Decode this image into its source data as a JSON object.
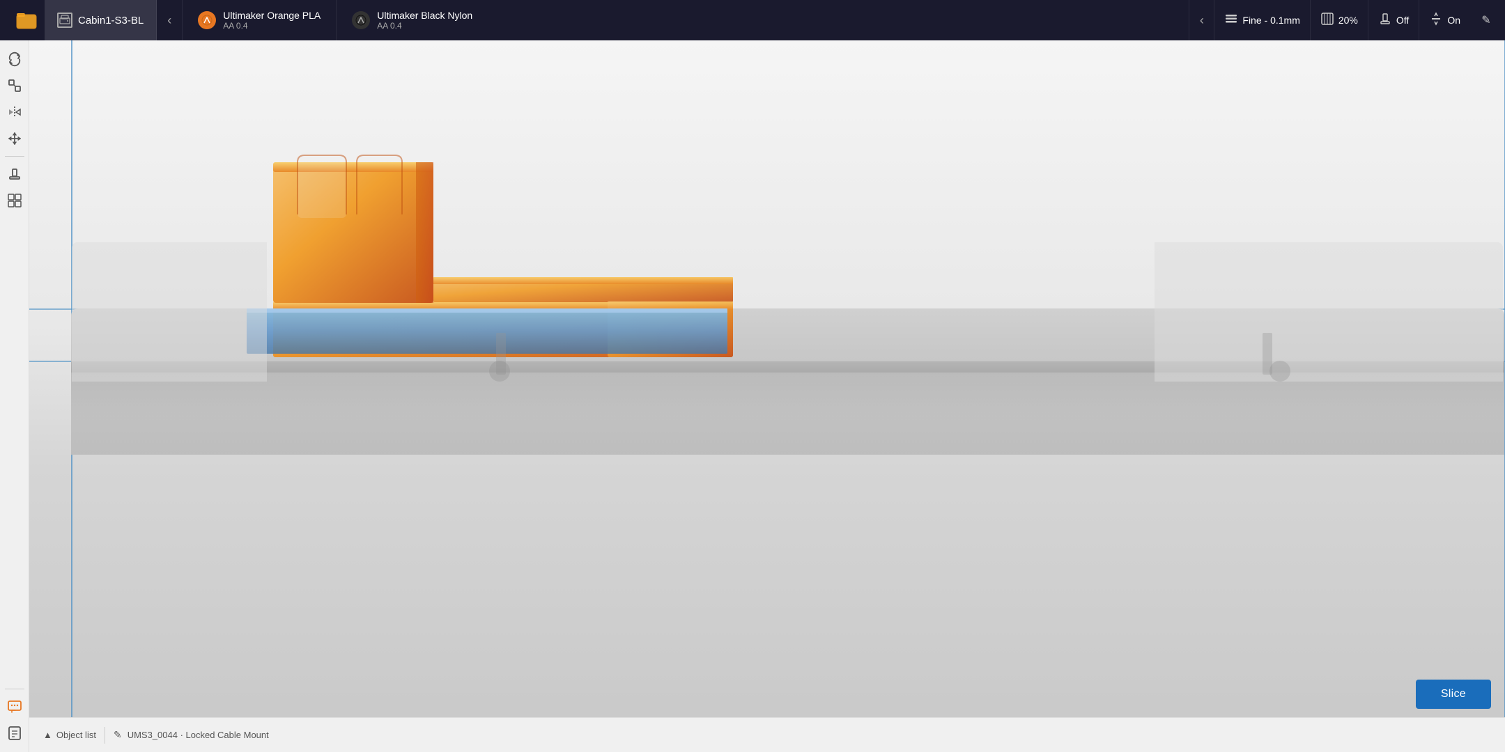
{
  "topbar": {
    "folder_label": "Open folder",
    "printer_name": "Cabin1-S3-BL",
    "nav_back": "‹",
    "material1": {
      "name": "Ultimaker Orange PLA",
      "nozzle": "AA 0.4",
      "icon_color": "#e87722"
    },
    "material2": {
      "name": "Ultimaker Black Nylon",
      "nozzle": "AA 0.4",
      "icon_color": "#222222"
    },
    "print_quality_label": "Fine - 0.1mm",
    "infill_label": "20%",
    "support_label": "Off",
    "adhesion_label": "On",
    "edit_icon": "✎"
  },
  "sidebar": {
    "tools": [
      {
        "id": "rotate",
        "icon": "⟳",
        "label": "Rotate"
      },
      {
        "id": "scale",
        "icon": "⤢",
        "label": "Scale"
      },
      {
        "id": "mirror",
        "icon": "⇌",
        "label": "Mirror"
      },
      {
        "id": "move",
        "icon": "✛",
        "label": "Move"
      },
      {
        "id": "support",
        "icon": "⚑",
        "label": "Support"
      },
      {
        "id": "mesh",
        "icon": "⊞",
        "label": "Mesh"
      }
    ],
    "bottom_tools": [
      {
        "id": "chat1",
        "icon": "💬",
        "label": "Chat"
      },
      {
        "id": "chat2",
        "icon": "📋",
        "label": "Notes"
      }
    ]
  },
  "bottombar": {
    "object_list_label": "Object list",
    "object_name": "UMS3_0044 · Locked Cable Mount",
    "expand_icon": "▲"
  },
  "viewport": {
    "build_line_y_percent": 43
  }
}
